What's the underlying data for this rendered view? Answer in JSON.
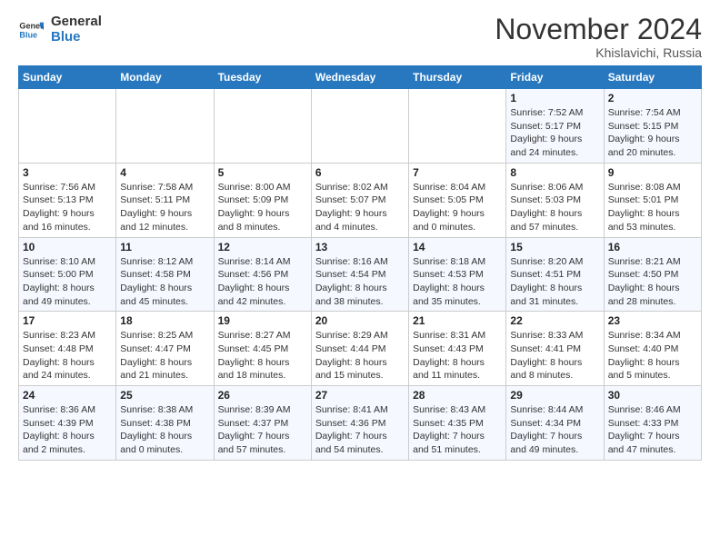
{
  "logo": {
    "line1": "General",
    "line2": "Blue"
  },
  "header": {
    "month": "November 2024",
    "location": "Khislavichi, Russia"
  },
  "weekdays": [
    "Sunday",
    "Monday",
    "Tuesday",
    "Wednesday",
    "Thursday",
    "Friday",
    "Saturday"
  ],
  "weeks": [
    [
      {
        "day": "",
        "sunrise": "",
        "sunset": "",
        "daylight": ""
      },
      {
        "day": "",
        "sunrise": "",
        "sunset": "",
        "daylight": ""
      },
      {
        "day": "",
        "sunrise": "",
        "sunset": "",
        "daylight": ""
      },
      {
        "day": "",
        "sunrise": "",
        "sunset": "",
        "daylight": ""
      },
      {
        "day": "",
        "sunrise": "",
        "sunset": "",
        "daylight": ""
      },
      {
        "day": "1",
        "sunrise": "Sunrise: 7:52 AM",
        "sunset": "Sunset: 5:17 PM",
        "daylight": "Daylight: 9 hours and 24 minutes."
      },
      {
        "day": "2",
        "sunrise": "Sunrise: 7:54 AM",
        "sunset": "Sunset: 5:15 PM",
        "daylight": "Daylight: 9 hours and 20 minutes."
      }
    ],
    [
      {
        "day": "3",
        "sunrise": "Sunrise: 7:56 AM",
        "sunset": "Sunset: 5:13 PM",
        "daylight": "Daylight: 9 hours and 16 minutes."
      },
      {
        "day": "4",
        "sunrise": "Sunrise: 7:58 AM",
        "sunset": "Sunset: 5:11 PM",
        "daylight": "Daylight: 9 hours and 12 minutes."
      },
      {
        "day": "5",
        "sunrise": "Sunrise: 8:00 AM",
        "sunset": "Sunset: 5:09 PM",
        "daylight": "Daylight: 9 hours and 8 minutes."
      },
      {
        "day": "6",
        "sunrise": "Sunrise: 8:02 AM",
        "sunset": "Sunset: 5:07 PM",
        "daylight": "Daylight: 9 hours and 4 minutes."
      },
      {
        "day": "7",
        "sunrise": "Sunrise: 8:04 AM",
        "sunset": "Sunset: 5:05 PM",
        "daylight": "Daylight: 9 hours and 0 minutes."
      },
      {
        "day": "8",
        "sunrise": "Sunrise: 8:06 AM",
        "sunset": "Sunset: 5:03 PM",
        "daylight": "Daylight: 8 hours and 57 minutes."
      },
      {
        "day": "9",
        "sunrise": "Sunrise: 8:08 AM",
        "sunset": "Sunset: 5:01 PM",
        "daylight": "Daylight: 8 hours and 53 minutes."
      }
    ],
    [
      {
        "day": "10",
        "sunrise": "Sunrise: 8:10 AM",
        "sunset": "Sunset: 5:00 PM",
        "daylight": "Daylight: 8 hours and 49 minutes."
      },
      {
        "day": "11",
        "sunrise": "Sunrise: 8:12 AM",
        "sunset": "Sunset: 4:58 PM",
        "daylight": "Daylight: 8 hours and 45 minutes."
      },
      {
        "day": "12",
        "sunrise": "Sunrise: 8:14 AM",
        "sunset": "Sunset: 4:56 PM",
        "daylight": "Daylight: 8 hours and 42 minutes."
      },
      {
        "day": "13",
        "sunrise": "Sunrise: 8:16 AM",
        "sunset": "Sunset: 4:54 PM",
        "daylight": "Daylight: 8 hours and 38 minutes."
      },
      {
        "day": "14",
        "sunrise": "Sunrise: 8:18 AM",
        "sunset": "Sunset: 4:53 PM",
        "daylight": "Daylight: 8 hours and 35 minutes."
      },
      {
        "day": "15",
        "sunrise": "Sunrise: 8:20 AM",
        "sunset": "Sunset: 4:51 PM",
        "daylight": "Daylight: 8 hours and 31 minutes."
      },
      {
        "day": "16",
        "sunrise": "Sunrise: 8:21 AM",
        "sunset": "Sunset: 4:50 PM",
        "daylight": "Daylight: 8 hours and 28 minutes."
      }
    ],
    [
      {
        "day": "17",
        "sunrise": "Sunrise: 8:23 AM",
        "sunset": "Sunset: 4:48 PM",
        "daylight": "Daylight: 8 hours and 24 minutes."
      },
      {
        "day": "18",
        "sunrise": "Sunrise: 8:25 AM",
        "sunset": "Sunset: 4:47 PM",
        "daylight": "Daylight: 8 hours and 21 minutes."
      },
      {
        "day": "19",
        "sunrise": "Sunrise: 8:27 AM",
        "sunset": "Sunset: 4:45 PM",
        "daylight": "Daylight: 8 hours and 18 minutes."
      },
      {
        "day": "20",
        "sunrise": "Sunrise: 8:29 AM",
        "sunset": "Sunset: 4:44 PM",
        "daylight": "Daylight: 8 hours and 15 minutes."
      },
      {
        "day": "21",
        "sunrise": "Sunrise: 8:31 AM",
        "sunset": "Sunset: 4:43 PM",
        "daylight": "Daylight: 8 hours and 11 minutes."
      },
      {
        "day": "22",
        "sunrise": "Sunrise: 8:33 AM",
        "sunset": "Sunset: 4:41 PM",
        "daylight": "Daylight: 8 hours and 8 minutes."
      },
      {
        "day": "23",
        "sunrise": "Sunrise: 8:34 AM",
        "sunset": "Sunset: 4:40 PM",
        "daylight": "Daylight: 8 hours and 5 minutes."
      }
    ],
    [
      {
        "day": "24",
        "sunrise": "Sunrise: 8:36 AM",
        "sunset": "Sunset: 4:39 PM",
        "daylight": "Daylight: 8 hours and 2 minutes."
      },
      {
        "day": "25",
        "sunrise": "Sunrise: 8:38 AM",
        "sunset": "Sunset: 4:38 PM",
        "daylight": "Daylight: 8 hours and 0 minutes."
      },
      {
        "day": "26",
        "sunrise": "Sunrise: 8:39 AM",
        "sunset": "Sunset: 4:37 PM",
        "daylight": "Daylight: 7 hours and 57 minutes."
      },
      {
        "day": "27",
        "sunrise": "Sunrise: 8:41 AM",
        "sunset": "Sunset: 4:36 PM",
        "daylight": "Daylight: 7 hours and 54 minutes."
      },
      {
        "day": "28",
        "sunrise": "Sunrise: 8:43 AM",
        "sunset": "Sunset: 4:35 PM",
        "daylight": "Daylight: 7 hours and 51 minutes."
      },
      {
        "day": "29",
        "sunrise": "Sunrise: 8:44 AM",
        "sunset": "Sunset: 4:34 PM",
        "daylight": "Daylight: 7 hours and 49 minutes."
      },
      {
        "day": "30",
        "sunrise": "Sunrise: 8:46 AM",
        "sunset": "Sunset: 4:33 PM",
        "daylight": "Daylight: 7 hours and 47 minutes."
      }
    ]
  ]
}
